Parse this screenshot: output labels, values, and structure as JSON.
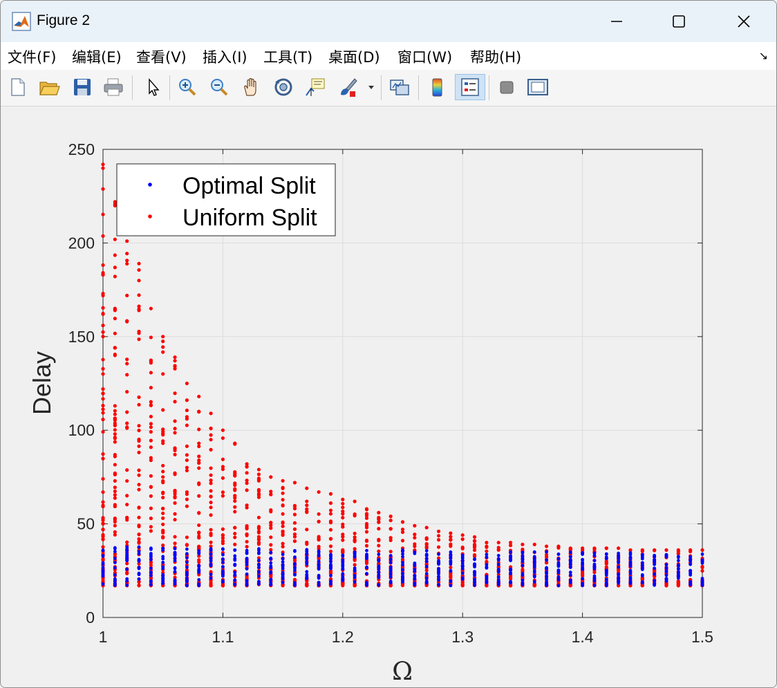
{
  "window": {
    "title": "Figure 2",
    "minimize_label": "—",
    "maximize_label": "☐",
    "close_label": "✕"
  },
  "menu": {
    "items": [
      "文件(F)",
      "编辑(E)",
      "查看(V)",
      "插入(I)",
      "工具(T)",
      "桌面(D)",
      "窗口(W)",
      "帮助(H)"
    ],
    "dock_label": "↘"
  },
  "toolbar": {
    "buttons": [
      {
        "icon": "new-figure-icon"
      },
      {
        "icon": "open-folder-icon"
      },
      {
        "icon": "save-icon"
      },
      {
        "icon": "print-icon"
      },
      {
        "icon": "select-arrow-icon"
      },
      {
        "icon": "zoom-in-icon"
      },
      {
        "icon": "zoom-out-icon"
      },
      {
        "icon": "pan-hand-icon"
      },
      {
        "icon": "rotate-3d-icon"
      },
      {
        "icon": "data-cursor-icon"
      },
      {
        "icon": "brush-icon"
      },
      {
        "icon": "link-plot-icon"
      },
      {
        "icon": "colorbar-icon"
      },
      {
        "icon": "legend-icon"
      },
      {
        "icon": "hide-plot-tools-icon"
      },
      {
        "icon": "show-plot-tools-icon"
      }
    ]
  },
  "colors": {
    "optimal": "#0000ff",
    "uniform": "#ff0000",
    "grid": "#dcdcdc"
  },
  "chart_data": {
    "type": "scatter",
    "title": "",
    "xlabel": "Ω",
    "ylabel": "Delay",
    "xlim": [
      1,
      1.5
    ],
    "ylim": [
      0,
      250
    ],
    "xticks": [
      1,
      1.1,
      1.2,
      1.3,
      1.4,
      1.5
    ],
    "xtick_labels": [
      "1",
      "1.1",
      "1.2",
      "1.3",
      "1.4",
      "1.5"
    ],
    "yticks": [
      0,
      50,
      100,
      150,
      200,
      250
    ],
    "ytick_labels": [
      "0",
      "50",
      "100",
      "150",
      "200",
      "250"
    ],
    "grid": true,
    "legend_position": "top-left",
    "x_step": 0.01,
    "series": [
      {
        "name": "Optimal Split",
        "color": "#0000ff",
        "min_delay": 17,
        "max_delay_start": 38,
        "max_delay_end": 34
      },
      {
        "name": "Uniform Split",
        "color": "#ff0000",
        "min_delay": 17,
        "upper_envelope": {
          "1.00": 242,
          "1.01": 222,
          "1.02": 201,
          "1.03": 189,
          "1.04": 165,
          "1.05": 150,
          "1.06": 139,
          "1.07": 125,
          "1.08": 118,
          "1.09": 109,
          "1.10": 100,
          "1.11": 93,
          "1.12": 82,
          "1.13": 79,
          "1.14": 75,
          "1.15": 73,
          "1.16": 72,
          "1.17": 69,
          "1.18": 67,
          "1.19": 66,
          "1.20": 63,
          "1.21": 62,
          "1.22": 58,
          "1.23": 56,
          "1.24": 54,
          "1.25": 51,
          "1.26": 49,
          "1.27": 48,
          "1.28": 46,
          "1.29": 45,
          "1.30": 44,
          "1.31": 43,
          "1.32": 40,
          "1.33": 40,
          "1.34": 40,
          "1.35": 39,
          "1.36": 39,
          "1.37": 38,
          "1.38": 38,
          "1.39": 37,
          "1.40": 37,
          "1.41": 37,
          "1.42": 37,
          "1.43": 37,
          "1.44": 36,
          "1.45": 36,
          "1.46": 36,
          "1.47": 36,
          "1.48": 36,
          "1.49": 36,
          "1.50": 36
        }
      }
    ]
  }
}
